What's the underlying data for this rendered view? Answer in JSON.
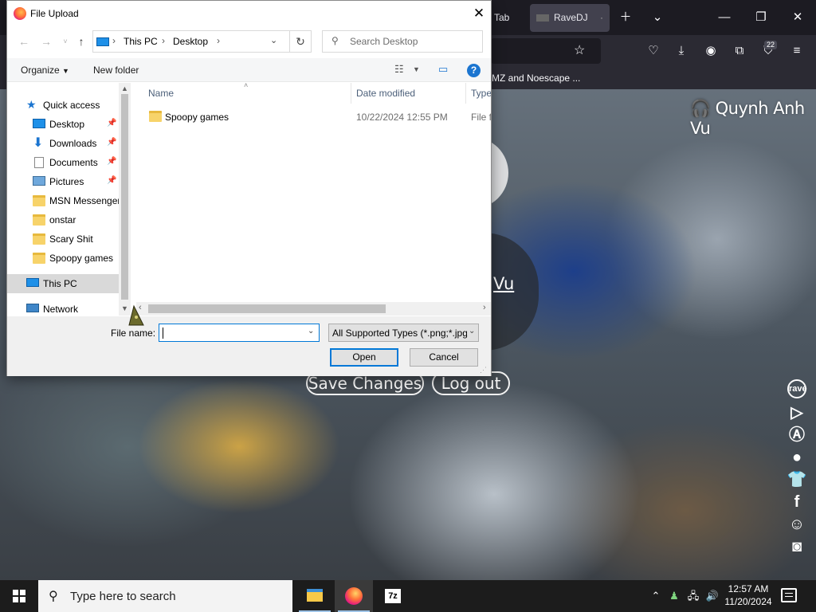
{
  "browser": {
    "tabs": [
      {
        "label": "Tab"
      },
      {
        "label": "RaveDJ"
      }
    ],
    "bookmark_text": "MZ and Noescape ...",
    "badge_count": "22"
  },
  "page": {
    "user_name": "Quynh Anh Vu",
    "avatar_name": "Vu",
    "save_changes": "Save Changes",
    "log_out": "Log out",
    "side_icons": [
      "rave-icon",
      "google-play-icon",
      "app-store-icon",
      "patreon-icon",
      "tshirt-icon",
      "facebook-icon",
      "reddit-icon",
      "discord-icon"
    ]
  },
  "dialog": {
    "title": "File Upload",
    "breadcrumb": [
      "This PC",
      "Desktop"
    ],
    "search_placeholder": "Search Desktop",
    "organize": "Organize",
    "new_folder": "New folder",
    "nav_items": [
      {
        "label": "Quick access",
        "icon": "star-icon"
      },
      {
        "label": "Desktop",
        "icon": "desktop-icon",
        "pinned": true
      },
      {
        "label": "Downloads",
        "icon": "download-icon",
        "pinned": true
      },
      {
        "label": "Documents",
        "icon": "documents-icon",
        "pinned": true
      },
      {
        "label": "Pictures",
        "icon": "pictures-icon",
        "pinned": true
      },
      {
        "label": "MSN Messenger",
        "icon": "folder-icon"
      },
      {
        "label": "onstar",
        "icon": "folder-icon"
      },
      {
        "label": "Scary Shit",
        "icon": "folder-icon"
      },
      {
        "label": "Spoopy games",
        "icon": "folder-icon"
      },
      {
        "label": "This PC",
        "icon": "pc-icon"
      },
      {
        "label": "Network",
        "icon": "network-icon"
      }
    ],
    "columns": {
      "name": "Name",
      "date_modified": "Date modified",
      "type": "Type"
    },
    "files": [
      {
        "name": "Spoopy games",
        "date_modified": "10/22/2024 12:55 PM",
        "type": "File folder"
      }
    ],
    "file_name_label": "File name:",
    "file_name_value": "",
    "file_type": "All Supported Types (*.png;*.jpg",
    "open": "Open",
    "cancel": "Cancel"
  },
  "taskbar": {
    "search_placeholder": "Type here to search",
    "time": "12:57 AM",
    "date": "11/20/2024"
  }
}
